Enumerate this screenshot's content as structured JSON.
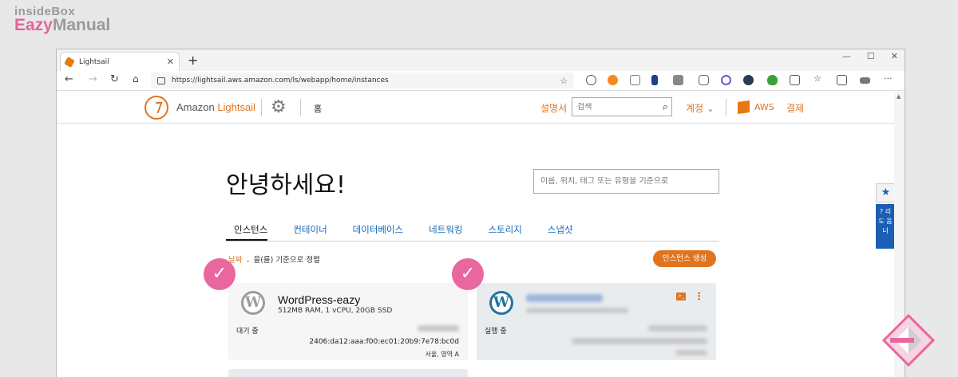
{
  "watermark": {
    "line1": "insideBox",
    "line2_e": "Eazy",
    "line2_rest": "Manual"
  },
  "browser": {
    "tab_title": "Lightsail",
    "tab_close": "✕",
    "new_tab": "+",
    "url": "https://lightsail.aws.amazon.com/ls/webapp/home/instances"
  },
  "header": {
    "brand_prefix": "Amazon ",
    "brand_name": "Lightsail",
    "home": "홈",
    "docs": "설명서",
    "search_placeholder": "검색",
    "account": "계정 ⌄",
    "aws": "AWS",
    "billing": "결제"
  },
  "side": {
    "help_label": "? 리 도 움 너"
  },
  "main": {
    "greeting": "안녕하세요!",
    "filter_placeholder": "이름, 위치, 태그 또는 유형을 기준으로",
    "tabs": [
      "인스턴스",
      "컨테이너",
      "데이터베이스",
      "네트워킹",
      "스토리지",
      "스냅샷"
    ],
    "sort_key": "날짜 ⌄",
    "sort_rest": " 을(를) 기준으로 정렬",
    "create_button": "인스턴스 생성"
  },
  "instances": [
    {
      "name": "WordPress-eazy",
      "spec": "512MB RAM, 1 vCPU, 20GB SSD",
      "status": "대기 중",
      "ip": "2406:da12:aaa:f00:ec01:20b9:7e78:bc0d",
      "zone": "서울, 영역 A"
    },
    {
      "status": "실행 중"
    }
  ],
  "colors": {
    "accent": "#e0741f",
    "link": "#1668b8",
    "highlight": "#e9679e"
  }
}
